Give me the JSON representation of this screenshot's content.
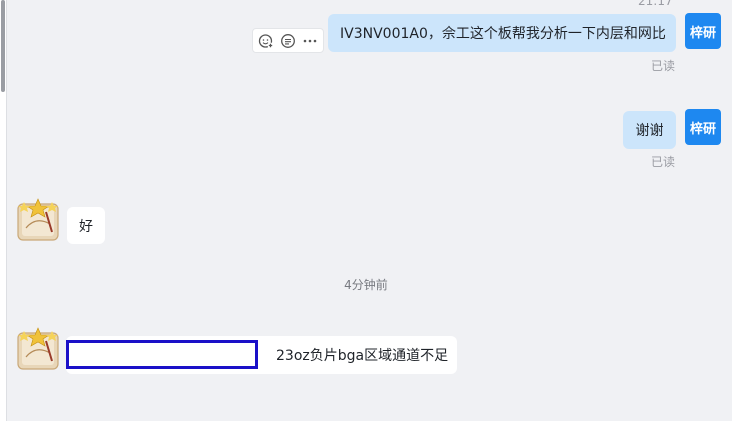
{
  "conversation": {
    "top_time": "21:17",
    "divider_time": "4分钟前",
    "messages": [
      {
        "sender": "me",
        "avatar_label": "梓研",
        "text": "IV3NV001A0，佘工这个板帮我分析一下内层和网比",
        "status": "已读"
      },
      {
        "sender": "me",
        "avatar_label": "梓研",
        "text": "谢谢",
        "status": "已读"
      },
      {
        "sender": "them",
        "text": "好"
      },
      {
        "sender": "them",
        "text": "23oz负片bga区域通道不足"
      }
    ]
  },
  "message_actions": {
    "icons": [
      "add-reaction-icon",
      "reply-icon",
      "more-icon"
    ]
  },
  "colors": {
    "background": "#f0f1f4",
    "my_bubble": "#cce5fb",
    "their_bubble": "#ffffff",
    "avatar_blue": "#1e88f0",
    "highlight_box": "#1a10c8"
  }
}
